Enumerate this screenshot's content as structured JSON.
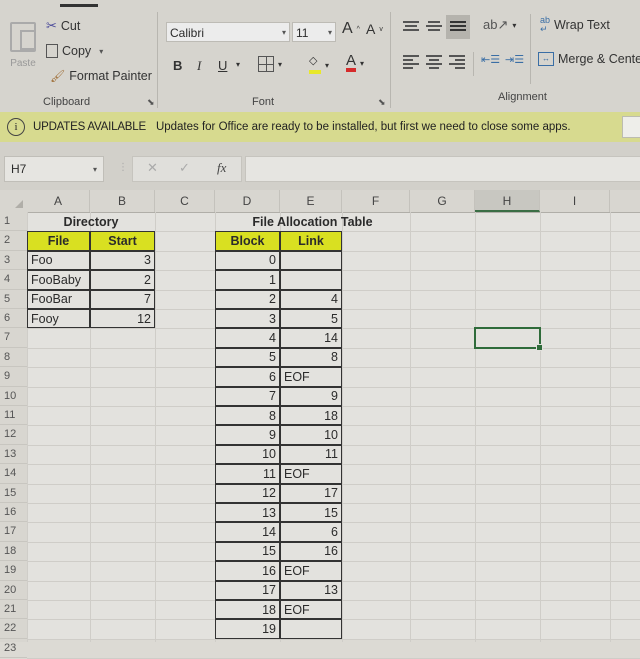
{
  "ribbon": {
    "clipboard": {
      "paste_label": "Paste",
      "cut_label": "Cut",
      "copy_label": "Copy",
      "format_painter_label": "Format Painter",
      "group_label": "Clipboard"
    },
    "font": {
      "font_name": "Calibri",
      "font_size": "11",
      "bold": "B",
      "italic": "I",
      "underline": "U",
      "grow": "A",
      "shrink": "A",
      "font_color_glyph": "A",
      "group_label": "Font",
      "font_color": "#d62b2b",
      "highlight_color": "#e8e82a"
    },
    "alignment": {
      "wrap_text_label": "Wrap Text",
      "merge_center_label": "Merge & Center",
      "group_label": "Alignment"
    }
  },
  "notification": {
    "title": "UPDATES AVAILABLE",
    "message": "Updates for Office are ready to be installed, but first we need to close some apps."
  },
  "formula_bar": {
    "name_box": "H7",
    "cancel_glyph": "✕",
    "enter_glyph": "✓",
    "fx_glyph": "fx",
    "formula": ""
  },
  "sheet": {
    "columns": [
      "A",
      "B",
      "C",
      "D",
      "E",
      "F",
      "G",
      "H",
      "I"
    ],
    "selected_column": "H",
    "selected_cell": "H7",
    "rows": [
      "1",
      "2",
      "3",
      "4",
      "5",
      "6",
      "7",
      "8",
      "9",
      "10",
      "11",
      "12",
      "13",
      "14",
      "15",
      "16",
      "17",
      "18",
      "19",
      "20",
      "21",
      "22",
      "23"
    ],
    "directory": {
      "title": "Directory",
      "headers": [
        "File",
        "Start"
      ],
      "entries": [
        {
          "file": "Foo",
          "start": "3"
        },
        {
          "file": "FooBaby",
          "start": "2"
        },
        {
          "file": "FooBar",
          "start": "7"
        },
        {
          "file": "Fooy",
          "start": "12"
        }
      ]
    },
    "fat": {
      "title": "File Allocation Table",
      "headers": [
        "Block",
        "Link"
      ],
      "entries": [
        {
          "block": "0",
          "link": ""
        },
        {
          "block": "1",
          "link": ""
        },
        {
          "block": "2",
          "link": "4"
        },
        {
          "block": "3",
          "link": "5"
        },
        {
          "block": "4",
          "link": "14"
        },
        {
          "block": "5",
          "link": "8"
        },
        {
          "block": "6",
          "link": "EOF"
        },
        {
          "block": "7",
          "link": "9"
        },
        {
          "block": "8",
          "link": "18"
        },
        {
          "block": "9",
          "link": "10"
        },
        {
          "block": "10",
          "link": "11"
        },
        {
          "block": "11",
          "link": "EOF"
        },
        {
          "block": "12",
          "link": "17"
        },
        {
          "block": "13",
          "link": "15"
        },
        {
          "block": "14",
          "link": "6"
        },
        {
          "block": "15",
          "link": "16"
        },
        {
          "block": "16",
          "link": "EOF"
        },
        {
          "block": "17",
          "link": "13"
        },
        {
          "block": "18",
          "link": "EOF"
        },
        {
          "block": "19",
          "link": ""
        }
      ]
    },
    "header_fill_color": "#d9e021",
    "selection_color": "#2f6b3a"
  }
}
